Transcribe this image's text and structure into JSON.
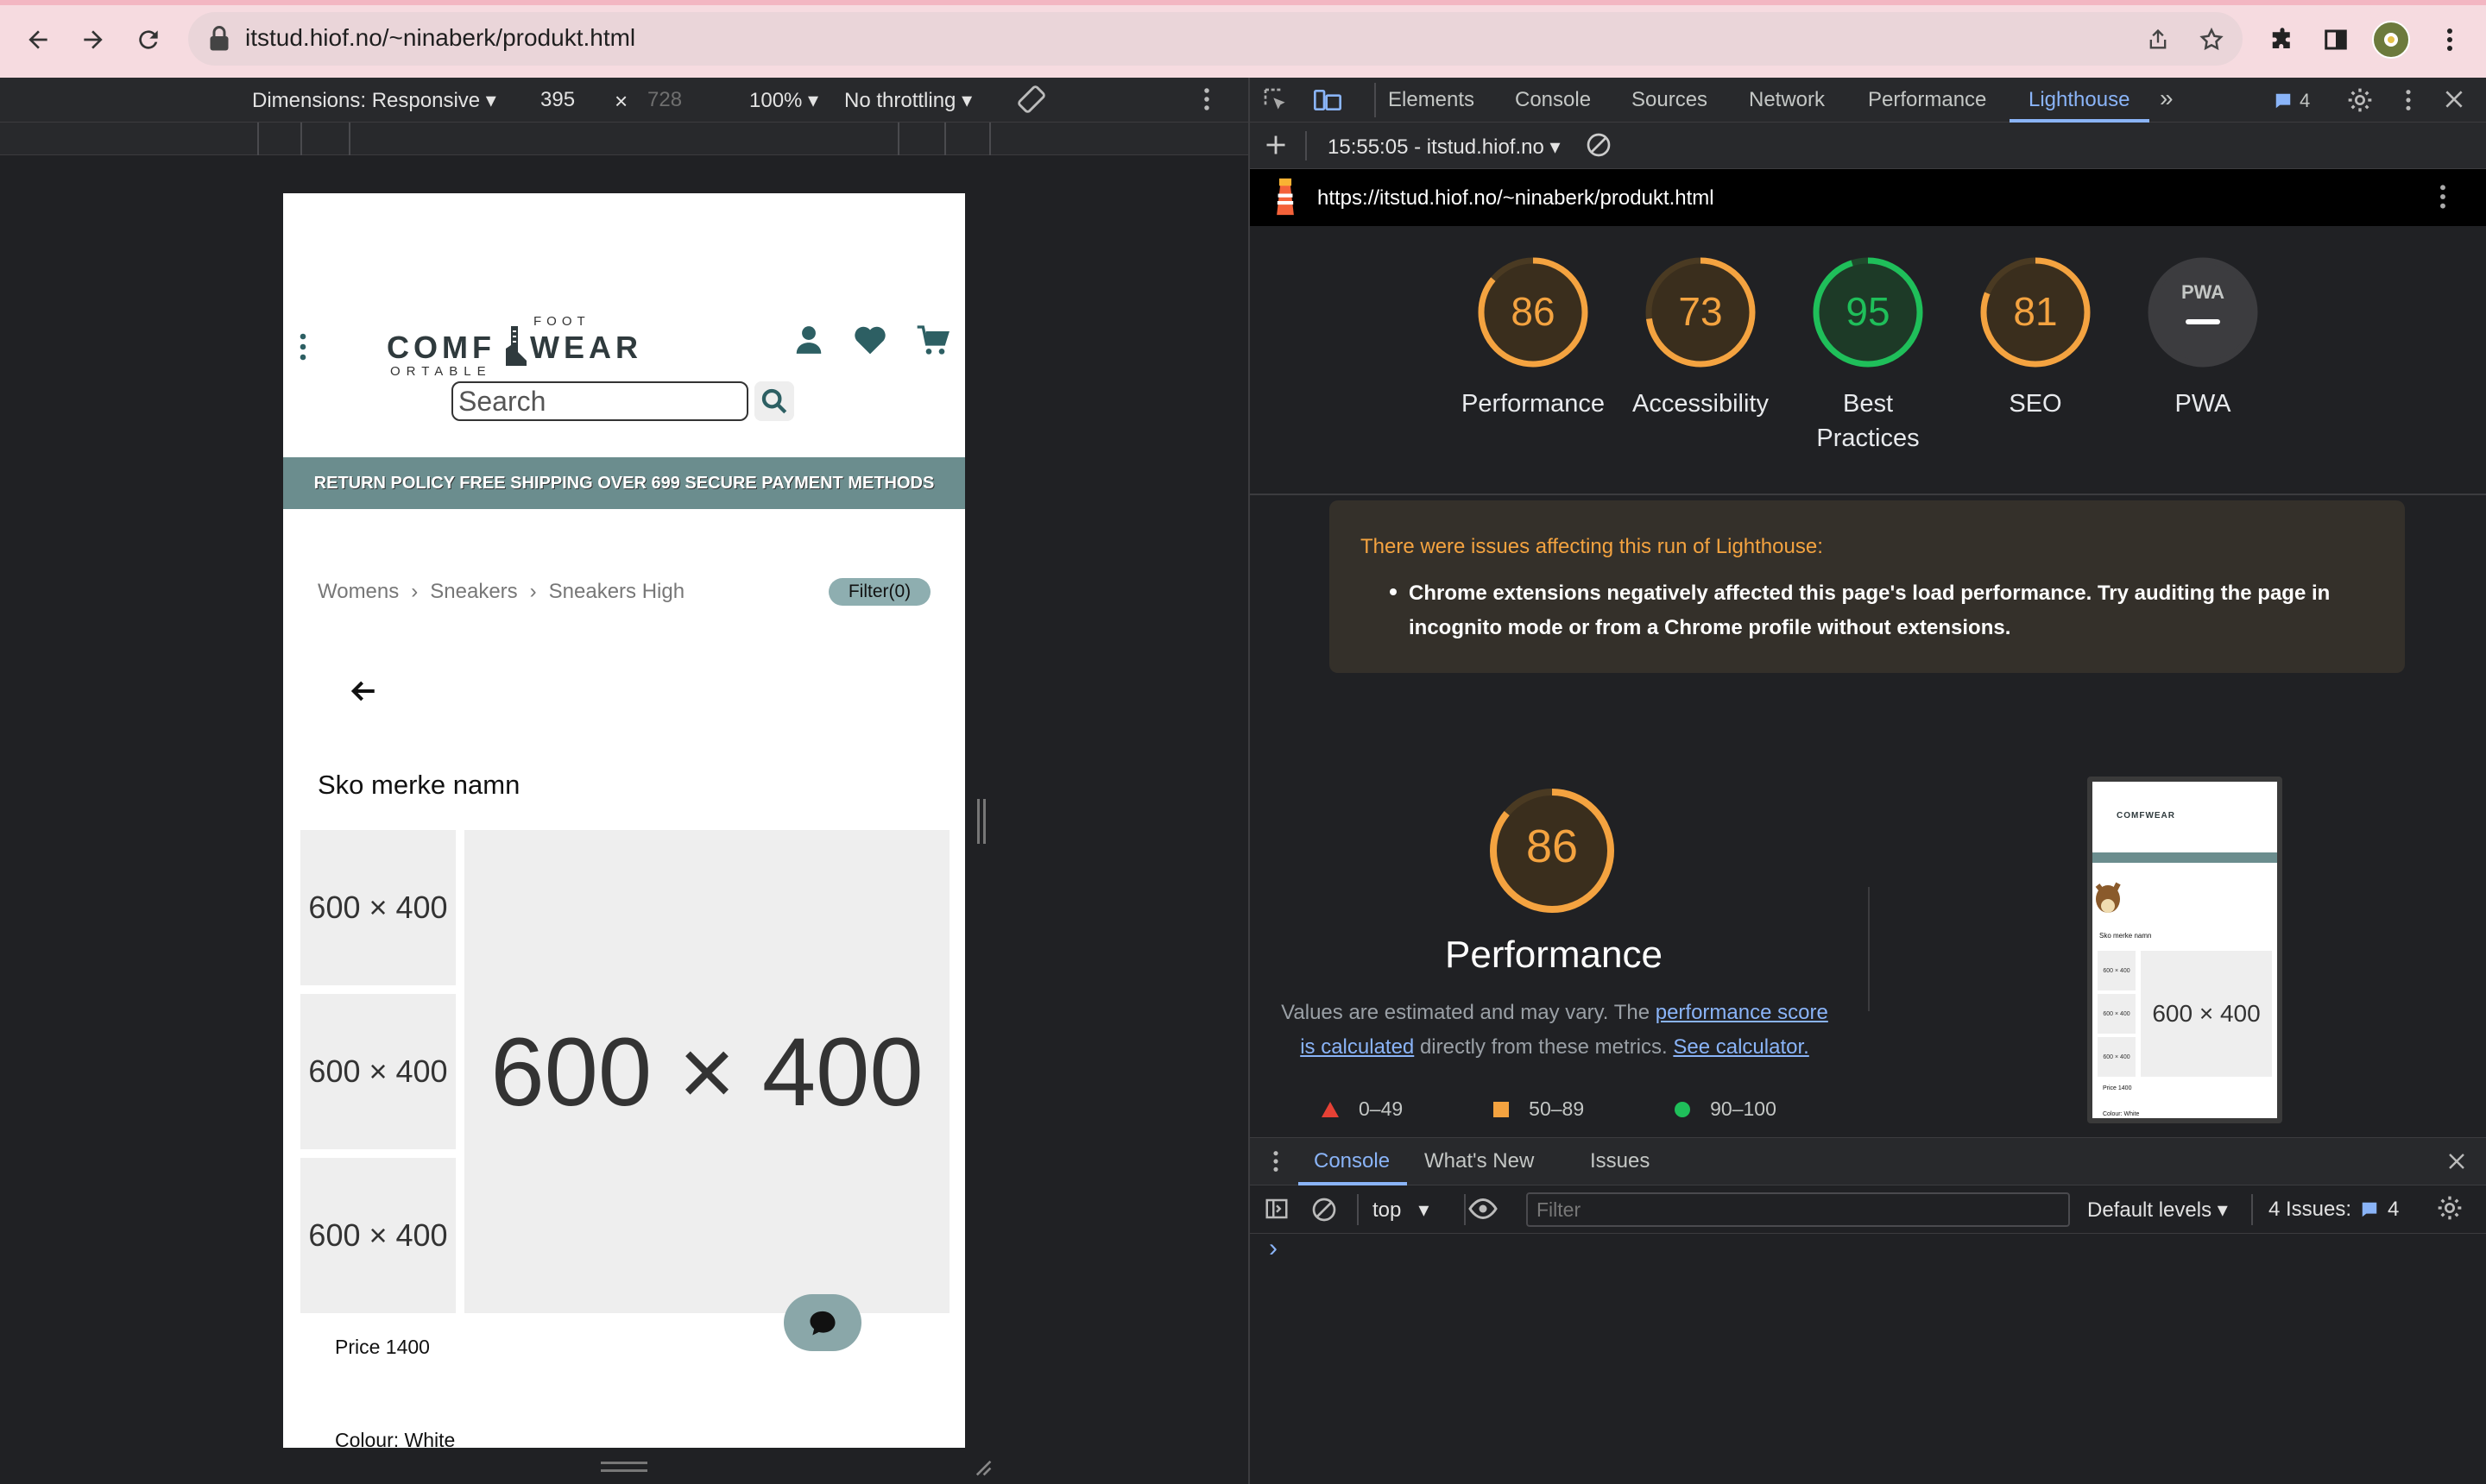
{
  "browser": {
    "url": "itstud.hiof.no/~ninaberk/produkt.html"
  },
  "device_toolbar": {
    "dimensions": "Dimensions: Responsive",
    "width": "395",
    "times": "×",
    "height": "728",
    "zoom": "100%",
    "throttling": "No throttling"
  },
  "page": {
    "logo_top": "FOOT",
    "logo_main_left": "COMF",
    "logo_main_right": "WEAR",
    "logo_bottom": "ORTABLE",
    "search_placeholder": "Search",
    "banner": "RETURN POLICY FREE SHIPPING OVER 699 SECURE PAYMENT METHODS",
    "breadcrumb": [
      "Womens",
      "Sneakers",
      "Sneakers High"
    ],
    "filter": "Filter(0)",
    "product_name": "Sko merke namn",
    "thumbs": [
      "600 × 400",
      "600 × 400",
      "600 × 400"
    ],
    "main_image": "600 × 400",
    "price": "Price 1400",
    "colour": "Colour: White"
  },
  "devtools": {
    "tabs": [
      "Elements",
      "Console",
      "Sources",
      "Network",
      "Performance",
      "Lighthouse"
    ],
    "active_tab": "Lighthouse",
    "issues_count": "4",
    "report_label": "15:55:05 - itstud.hiof.no",
    "report_url": "https://itstud.hiof.no/~ninaberk/produkt.html",
    "scores": [
      {
        "value": "86",
        "label": "Performance",
        "color": "#f4a340"
      },
      {
        "value": "73",
        "label": "Accessibility",
        "color": "#f4a340"
      },
      {
        "value": "95",
        "label": "Best Practices",
        "color": "#1fbf5a"
      },
      {
        "value": "81",
        "label": "SEO",
        "color": "#f4a340"
      },
      {
        "value": "PWA",
        "label": "PWA",
        "color": "#9aa0a6"
      }
    ],
    "warning_title": "There were issues affecting this run of Lighthouse:",
    "warning_body": "Chrome extensions negatively affected this page's load performance. Try auditing the page in incognito mode or from a Chrome profile without extensions.",
    "perf_score": "86",
    "perf_title": "Performance",
    "perf_desc_1": "Values are estimated and may vary. The ",
    "perf_link_1": "performance score is calculated",
    "perf_desc_2": " directly from these metrics. ",
    "perf_link_2": "See calculator.",
    "legend": [
      "0–49",
      "50–89",
      "90–100"
    ],
    "thumb_text": "600 × 400",
    "thumb_small": [
      "600 × 400",
      "600 × 400",
      "600 × 400"
    ],
    "thumb_title": "Sko merke namn",
    "thumb_price": "Price 1400",
    "thumb_colour": "Colour: White"
  },
  "console": {
    "tabs": [
      "Console",
      "What's New",
      "Issues"
    ],
    "context": "top",
    "filter_placeholder": "Filter",
    "levels": "Default levels",
    "issues": "4 Issues:",
    "issues_count": "4",
    "prompt": "›"
  }
}
